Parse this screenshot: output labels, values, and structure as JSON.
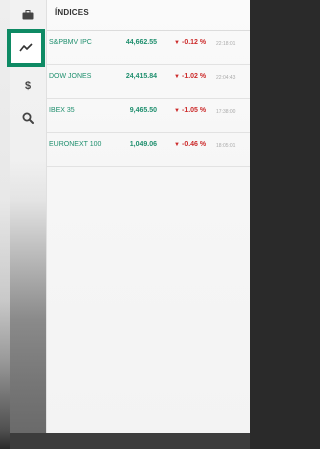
{
  "header": {
    "title": "ÍNDICES"
  },
  "nav": {
    "items": [
      {
        "icon": "briefcase-icon"
      },
      {
        "icon": "trend-chart-icon",
        "selected": true
      },
      {
        "icon": "dollar-icon"
      },
      {
        "icon": "search-icon"
      }
    ]
  },
  "indices": [
    {
      "name": "S&PBMV IPC",
      "value": "44,662.55",
      "change": "-0.12 %",
      "time": "22:18:01"
    },
    {
      "name": "DOW JONES",
      "value": "24,415.84",
      "change": "-1.02 %",
      "time": "22:04:43"
    },
    {
      "name": "IBEX 35",
      "value": "9,465.50",
      "change": "-1.05 %",
      "time": "17:38:00"
    },
    {
      "name": "EURONEXT 100",
      "value": "1,049.06",
      "change": "-0.46 %",
      "time": "18:05:01"
    }
  ],
  "colors": {
    "accent": "#0e8a64",
    "positive_text": "#1f8f6e",
    "negative": "#cc2a2a"
  }
}
